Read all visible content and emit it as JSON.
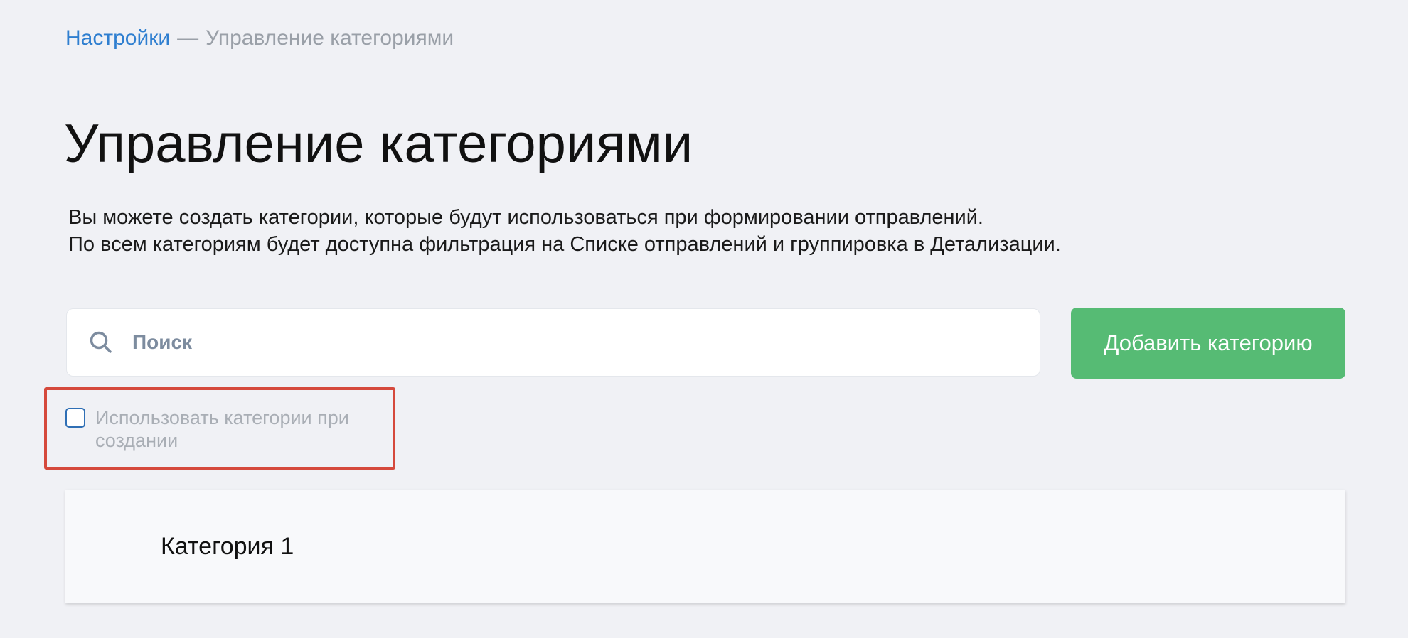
{
  "breadcrumb": {
    "parent": "Настройки",
    "separator": "—",
    "current": "Управление категориями"
  },
  "page": {
    "title": "Управление категориями",
    "description_line1": "Вы можете создать категории, которые будут использоваться при формировании отправлений.",
    "description_line2": "По всем категориям будет доступна фильтрация на Списке отправлений и группировка в Детализации."
  },
  "search": {
    "placeholder": "Поиск",
    "value": "",
    "icon": "search-icon"
  },
  "toolbar": {
    "add_label": "Добавить категорию"
  },
  "options": {
    "use_categories_label": "Использовать категории при создании",
    "use_categories_checked": false
  },
  "categories": [
    {
      "name": "Категория 1"
    }
  ],
  "colors": {
    "accent": "#2f7fd0",
    "add_button": "#56bb74",
    "highlight": "#d5493c",
    "background": "#f0f1f5"
  }
}
